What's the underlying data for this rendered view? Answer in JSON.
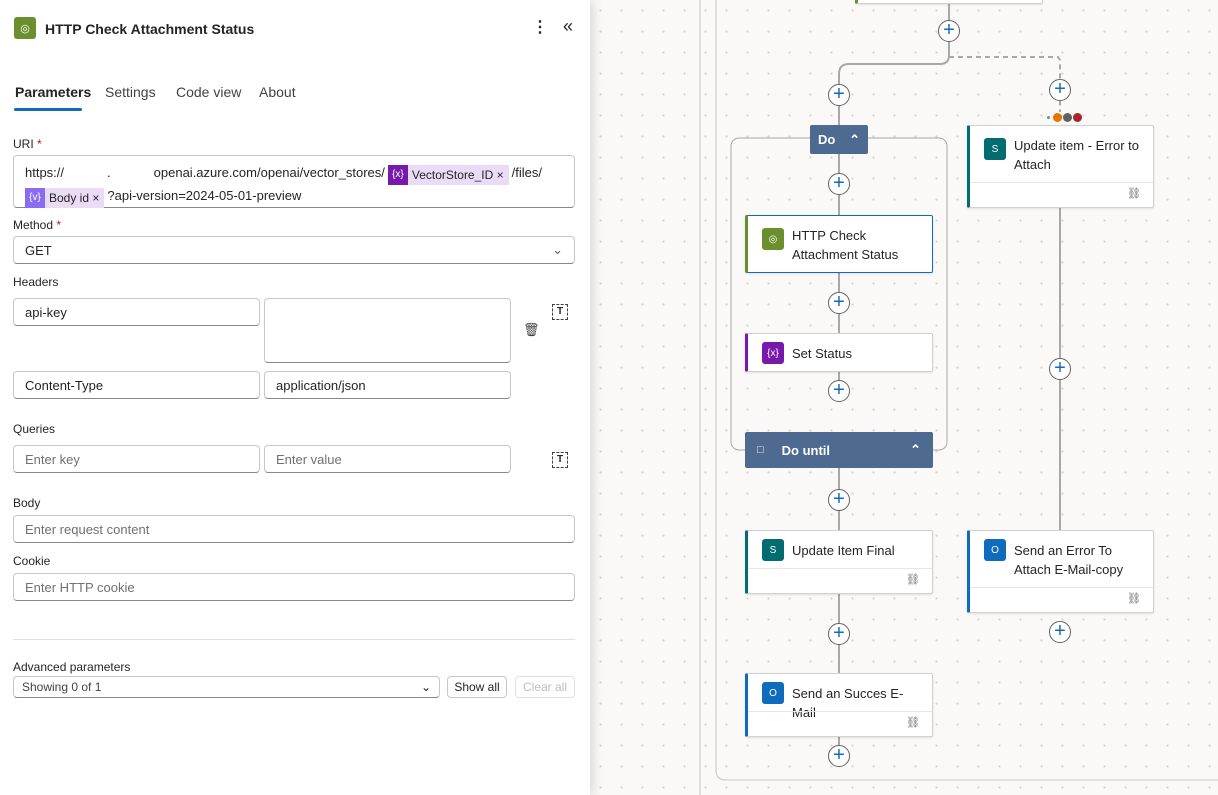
{
  "panel": {
    "title": "HTTP Check Attachment Status",
    "icon": "globe-icon",
    "tabs": [
      {
        "label": "Parameters"
      },
      {
        "label": "Settings"
      },
      {
        "label": "Code view"
      },
      {
        "label": "About"
      }
    ],
    "uri": {
      "label": "URI",
      "required": "*",
      "part1": "https://",
      "part1b": ".",
      "part2": "openai.azure.com/openai/vector_stores/",
      "token1": "VectorStore_ID",
      "part3": "/files/",
      "token2": "Body id",
      "part4": "?api-version=2024-05-01-preview"
    },
    "method": {
      "label": "Method",
      "required": "*",
      "value": "GET"
    },
    "headers": {
      "label": "Headers",
      "rows": [
        {
          "key": "api-key",
          "value": ""
        },
        {
          "key": "Content-Type",
          "value": "application/json"
        }
      ]
    },
    "queries": {
      "label": "Queries",
      "key_placeholder": "Enter key",
      "value_placeholder": "Enter value"
    },
    "body": {
      "label": "Body",
      "placeholder": "Enter request content"
    },
    "cookie": {
      "label": "Cookie",
      "placeholder": "Enter HTTP cookie"
    },
    "advanced": {
      "label": "Advanced parameters",
      "value": "Showing 0 of 1",
      "show_all": "Show all",
      "clear_all": "Clear all"
    }
  },
  "flow": {
    "do_label": "Do",
    "do_until_label": "Do until",
    "nodes": [
      {
        "title": "HTTP Check Attachment Status",
        "color": "#6c8f2e"
      },
      {
        "title": "Set Status",
        "color": "#7719aa"
      },
      {
        "title": "Update Item Final",
        "color": "#036c70"
      },
      {
        "title": "Send an Succes E-Mail",
        "color": "#0f6cbd"
      },
      {
        "title": "Update item - Error to Attach",
        "color": "#036c70"
      },
      {
        "title": "Send an Error To Attach E-Mail-copy",
        "color": "#0f6cbd"
      }
    ],
    "run_after_colors": [
      "#e97500",
      "#616161",
      "#a4262c"
    ]
  }
}
